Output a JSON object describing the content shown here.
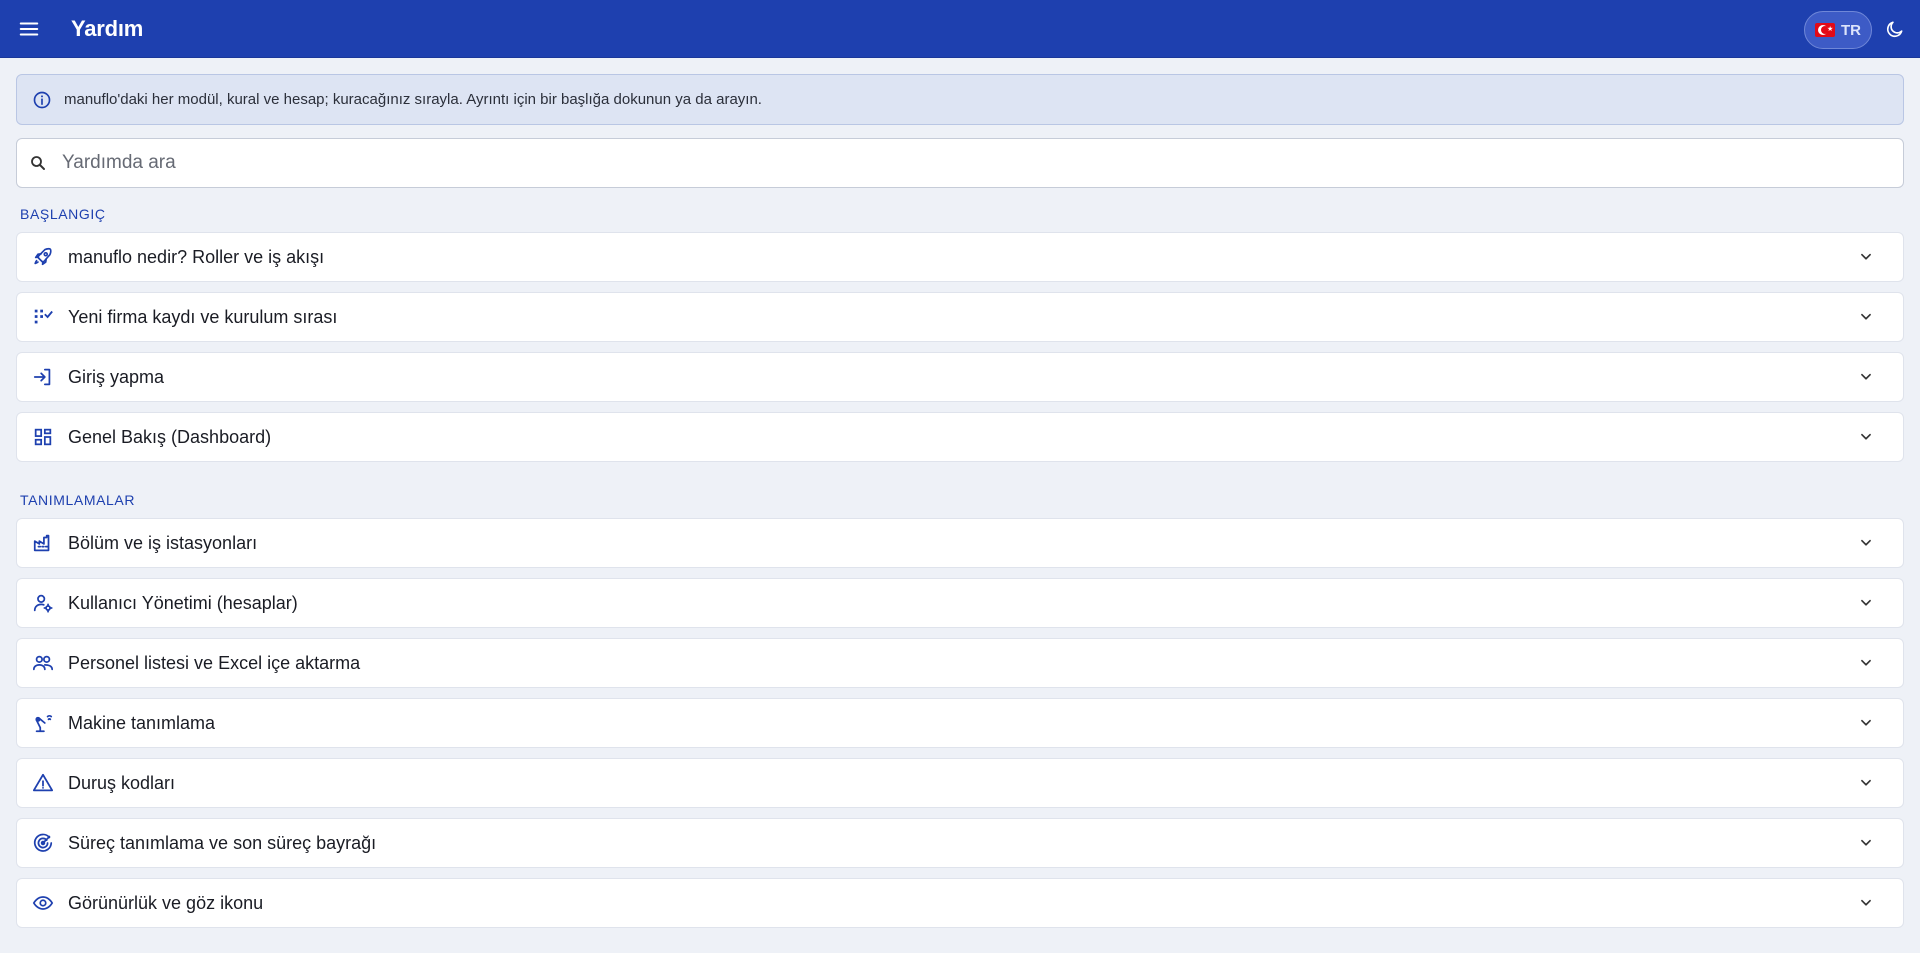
{
  "appbar": {
    "title": "Yardım",
    "language": "TR",
    "menu_icon": "menu-icon",
    "theme_icon": "moon-icon",
    "color": "#1e40af"
  },
  "info": {
    "text": "manuflo'daki her modül, kural ve hesap; kuracağınız sırayla. Ayrıntı için bir başlığa dokunun ya da arayın.",
    "icon": "info-icon"
  },
  "search": {
    "placeholder": "Yardımda ara",
    "value": "",
    "icon": "search-icon"
  },
  "sections": [
    {
      "title": "BAŞLANGIÇ",
      "items": [
        {
          "label": "manuflo nedir? Roller ve iş akışı",
          "icon": "rocket-icon"
        },
        {
          "label": "Yeni firma kaydı ve kurulum sırası",
          "icon": "checklist-icon"
        },
        {
          "label": "Giriş yapma",
          "icon": "login-icon"
        },
        {
          "label": "Genel Bakış (Dashboard)",
          "icon": "dashboard-icon"
        }
      ]
    },
    {
      "title": "TANIMLAMALAR",
      "items": [
        {
          "label": "Bölüm ve iş istasyonları",
          "icon": "factory-icon"
        },
        {
          "label": "Kullanıcı Yönetimi (hesaplar)",
          "icon": "user-settings-icon"
        },
        {
          "label": "Personel listesi ve Excel içe aktarma",
          "icon": "people-icon"
        },
        {
          "label": "Makine tanımlama",
          "icon": "robot-arm-icon"
        },
        {
          "label": "Duruş kodları",
          "icon": "warning-icon"
        },
        {
          "label": "Süreç tanımlama ve son süreç bayrağı",
          "icon": "target-icon"
        },
        {
          "label": "Görünürlük ve göz ikonu",
          "icon": "eye-icon"
        }
      ]
    }
  ]
}
